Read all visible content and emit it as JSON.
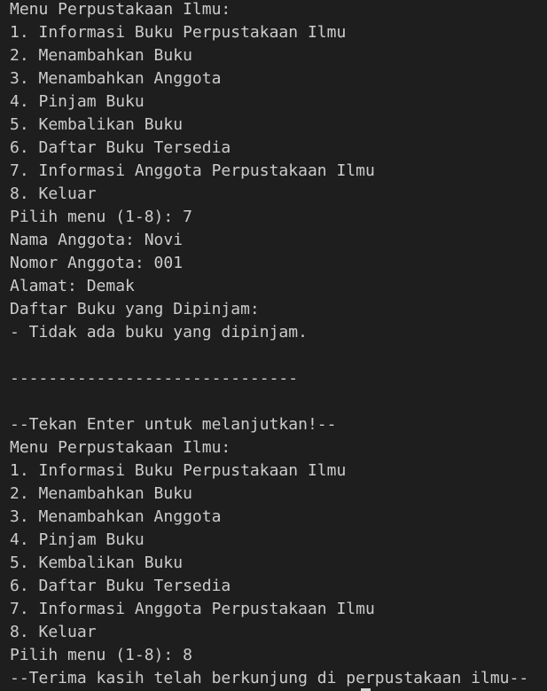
{
  "terminal": {
    "lines": [
      "Menu Perpustakaan Ilmu:",
      "1. Informasi Buku Perpustakaan Ilmu",
      "2. Menambahkan Buku",
      "3. Menambahkan Anggota",
      "4. Pinjam Buku",
      "5. Kembalikan Buku",
      "6. Daftar Buku Tersedia",
      "7. Informasi Anggota Perpustakaan Ilmu",
      "8. Keluar",
      "Pilih menu (1-8): 7",
      "Nama Anggota: Novi",
      "Nomor Anggota: 001",
      "Alamat: Demak",
      "Daftar Buku yang Dipinjam:",
      "- Tidak ada buku yang dipinjam.",
      "",
      "------------------------------",
      "",
      "--Tekan Enter untuk melanjutkan!--",
      "Menu Perpustakaan Ilmu:",
      "1. Informasi Buku Perpustakaan Ilmu",
      "2. Menambahkan Buku",
      "3. Menambahkan Anggota",
      "4. Pinjam Buku",
      "5. Kembalikan Buku",
      "6. Daftar Buku Tersedia",
      "7. Informasi Anggota Perpustakaan Ilmu",
      "8. Keluar",
      "Pilih menu (1-8): 8",
      "--Terima kasih telah berkunjung di perpustakaan ilmu--"
    ]
  },
  "colors": {
    "background": "#1e1e1e",
    "text": "#cccccc"
  }
}
